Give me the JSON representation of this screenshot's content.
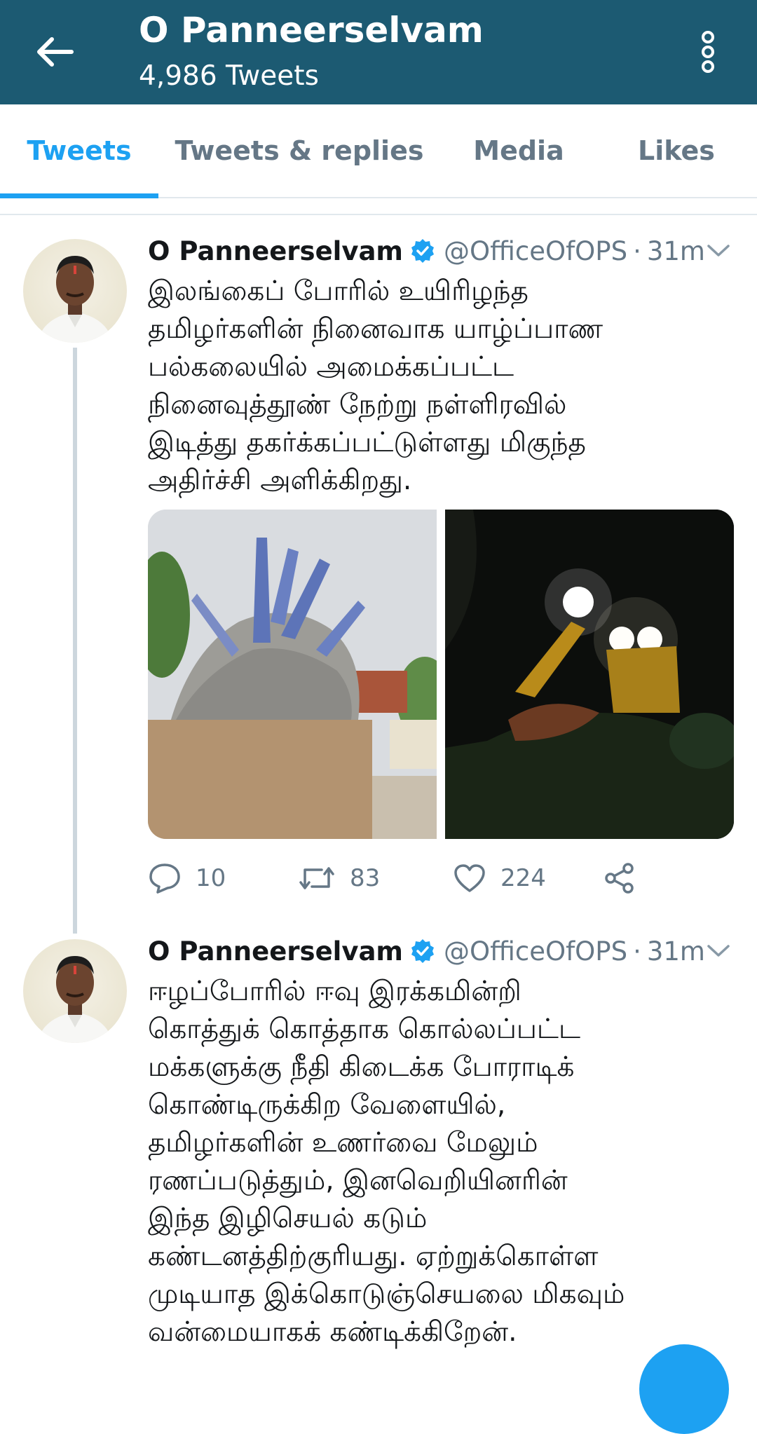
{
  "header": {
    "title": "O Panneerselvam",
    "subtitle": "4,986 Tweets",
    "bg_color": "#1c5a72"
  },
  "tabs": [
    {
      "label": "Tweets",
      "active": true
    },
    {
      "label": "Tweets & replies",
      "active": false
    },
    {
      "label": "Media",
      "active": false
    },
    {
      "label": "Likes",
      "active": false
    }
  ],
  "accent_color": "#1da1f2",
  "tweets": [
    {
      "author": "O Panneerselvam",
      "verified": true,
      "handle": "@OfficeOfOPS",
      "separator": "·",
      "time": "31m",
      "text": "இலங்கைப் போரில் உயிரிழந்த\nதமிழர்களின் நினைவாக யாழ்ப்பாண\nபல்கலையில் அமைக்கப்பட்ட\nநினைவுத்தூண் நேற்று நள்ளிரவில்\nஇடித்து தகர்க்கப்பட்டுள்ளது மிகுந்த\nஅதிர்ச்சி அளிக்கிறது.",
      "media": [
        "statue-photo",
        "excavator-night-photo"
      ],
      "replies": "10",
      "retweets": "83",
      "likes": "224"
    },
    {
      "author": "O Panneerselvam",
      "verified": true,
      "handle": "@OfficeOfOPS",
      "separator": "·",
      "time": "31m",
      "text": "ஈழப்போரில் ஈவு இரக்கமின்றி\nகொத்துக் கொத்தாக கொல்லப்பட்ட\nமக்களுக்கு நீதி கிடைக்க போராடிக்\nகொண்டிருக்கிற வேளையில்,\nதமிழர்களின் உணர்வை மேலும்\nரணப்படுத்தும், இனவெறியினரின்\nஇந்த இழிசெயல் கடும்\nகண்டனத்திற்குரியது. ஏற்றுக்கொள்ள\nமுடியாத இக்கொடுஞ்செயலை மிகவும்\nவன்மையாகக் கண்டிக்கிறேன்."
    }
  ]
}
